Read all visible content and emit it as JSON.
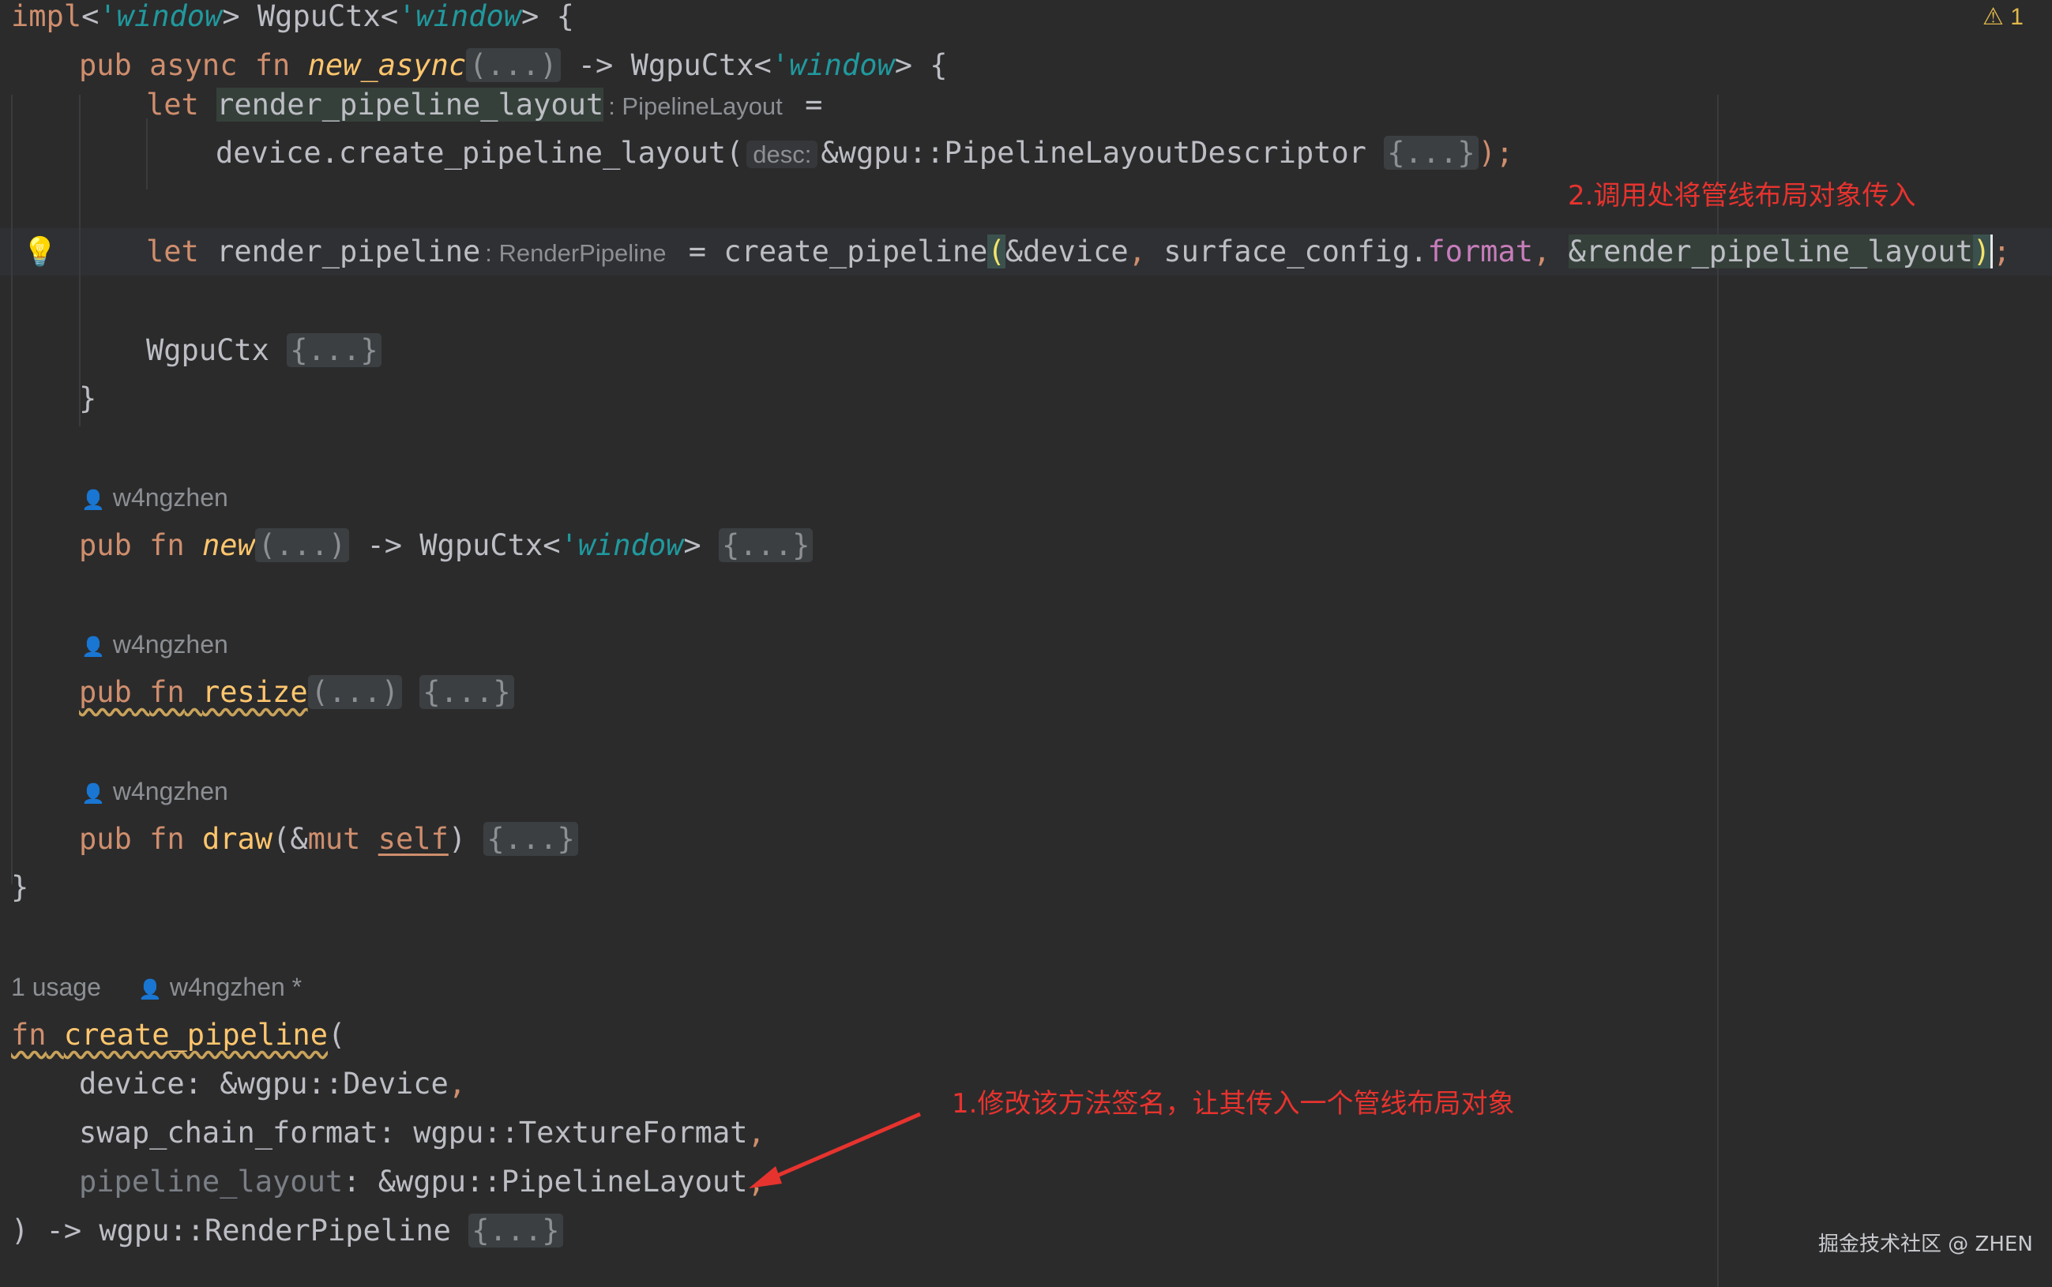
{
  "editor": {
    "lines": {
      "l1": {
        "impl": "impl",
        "lt1": "'window",
        "type": "WgpuCtx",
        "lt2": "'window",
        "end": "> {"
      },
      "l2": {
        "kw1": "pub",
        "kw2": "async",
        "kw3": "fn",
        "name": "new_async",
        "fold": "(...)",
        "arrow": " -> WgpuCtx<",
        "lt": "'window",
        "end": "> {"
      },
      "l3": {
        "kw": "let",
        "var": "render_pipeline_layout",
        "hint": ": PipelineLayout",
        "eq": " ="
      },
      "l4": {
        "code": "device.create_pipeline_layout(",
        "hint": "desc:",
        "code2": "&wgpu::PipelineLayoutDescriptor ",
        "fold": "{...}",
        "end": ");"
      },
      "l5": {
        "kw": "let",
        "var": "render_pipeline",
        "hint": ": RenderPipeline",
        "eq": " = ",
        "call": "create_pipeline",
        "paren": "(",
        "arg1": "&device",
        "comma1": ", ",
        "arg2a": "surface_config.",
        "arg2b": "format",
        "comma2": ", ",
        "arg3": "&render_pipeline_layout",
        "close": ")",
        "semi": ";"
      },
      "l6": {
        "type": "WgpuCtx ",
        "fold": "{...}"
      },
      "l7": {
        "close": "}"
      },
      "l8": {
        "kw1": "pub",
        "kw2": "fn",
        "name": "new",
        "fold": "(...)",
        "arrow": " -> WgpuCtx<",
        "lt": "'window",
        "end": "> ",
        "fold2": "{...}"
      },
      "l9": {
        "kw1": "pub",
        "kw2": "fn",
        "name": "resize",
        "fold": "(...)",
        "fold2": "{...}"
      },
      "l10": {
        "kw1": "pub",
        "kw2": "fn",
        "name": "draw",
        "p1": "(&",
        "mut": "mut",
        "self": "self",
        "p2": ") ",
        "fold": "{...}"
      },
      "l11": {
        "close": "}"
      },
      "l12": {
        "kw": "fn",
        "name": "create_pipeline",
        "paren": "("
      },
      "l13": {
        "param": "device",
        "type": ": &wgpu::Device",
        "comma": ","
      },
      "l14": {
        "param": "swap_chain_format",
        "type": ": wgpu::TextureFormat",
        "comma": ","
      },
      "l15": {
        "param": "pipeline_layout",
        "type": ": &wgpu::PipelineLayout",
        "comma": ","
      },
      "l16": {
        "code": ") -> wgpu::RenderPipeline ",
        "fold": "{...}"
      }
    },
    "authors": {
      "a1": "w4ngzhen",
      "a2": "w4ngzhen",
      "a3": "w4ngzhen",
      "usage": "1 usage",
      "a4": "w4ngzhen *"
    },
    "warning_count": "1"
  },
  "annotations": {
    "step1": "1.修改该方法签名，让其传入一个管线布局对象",
    "step2": "2.调用处将管线布局对象传入"
  },
  "watermark": "掘金技术社区 @ ZHEN",
  "colors": {
    "background": "#2b2b2c",
    "keyword": "#cf8e6d",
    "function": "#ffc66d",
    "lifetime": "#20999d",
    "annotation": "#e7332e"
  }
}
